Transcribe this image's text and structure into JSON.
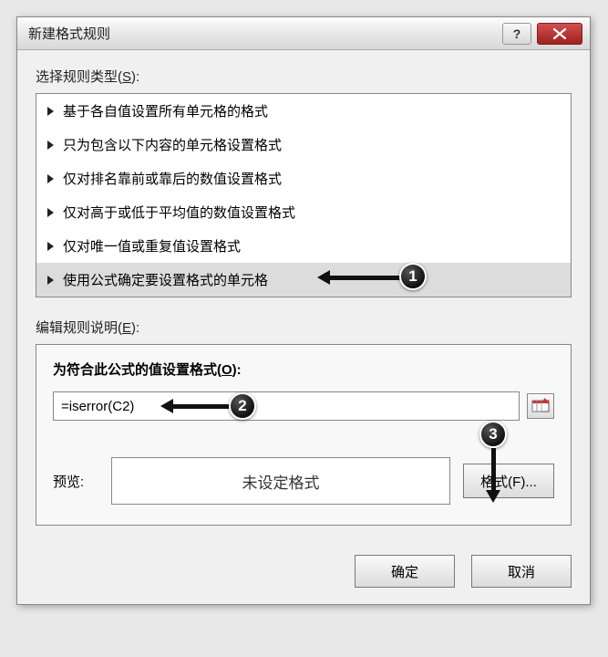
{
  "titlebar": {
    "title": "新建格式规则"
  },
  "labels": {
    "select_rule_type": "选择规则类型(",
    "select_rule_type_key": "S",
    "select_rule_type_close": "):",
    "edit_rule_desc": "编辑规则说明(",
    "edit_rule_desc_key": "E",
    "edit_rule_desc_close": "):",
    "format_values_where": "为符合此公式的值设置格式(",
    "format_values_where_key": "O",
    "format_values_where_close": "):",
    "preview": "预览:",
    "no_format_set": "未设定格式"
  },
  "rule_types": {
    "items": [
      {
        "label": "基于各自值设置所有单元格的格式"
      },
      {
        "label": "只为包含以下内容的单元格设置格式"
      },
      {
        "label": "仅对排名靠前或靠后的数值设置格式"
      },
      {
        "label": "仅对高于或低于平均值的数值设置格式"
      },
      {
        "label": "仅对唯一值或重复值设置格式"
      },
      {
        "label": "使用公式确定要设置格式的单元格"
      }
    ],
    "selected_index": 5
  },
  "formula": {
    "value": "=iserror(C2)"
  },
  "buttons": {
    "format": "格式(F)...",
    "ok": "确定",
    "cancel": "取消"
  },
  "callouts": {
    "c1": "1",
    "c2": "2",
    "c3": "3"
  }
}
